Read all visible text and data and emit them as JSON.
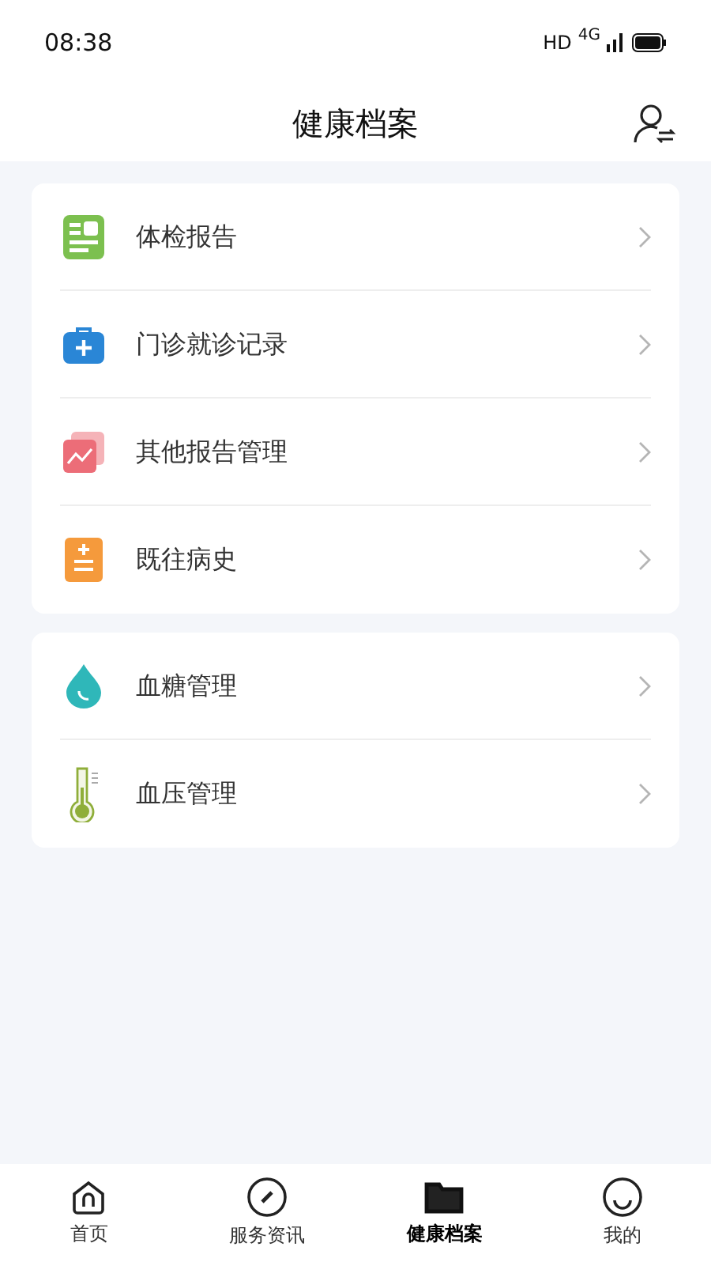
{
  "status_bar": {
    "time": "08:38",
    "network": "HD",
    "signal_label": "4G"
  },
  "header": {
    "title": "健康档案"
  },
  "groups": [
    {
      "items": [
        {
          "label": "体检报告"
        },
        {
          "label": "门诊就诊记录"
        },
        {
          "label": "其他报告管理"
        },
        {
          "label": "既往病史"
        }
      ]
    },
    {
      "items": [
        {
          "label": "血糖管理"
        },
        {
          "label": "血压管理"
        }
      ]
    }
  ],
  "tabs": [
    {
      "label": "首页",
      "selected": false
    },
    {
      "label": "服务资讯",
      "selected": false
    },
    {
      "label": "健康档案",
      "selected": true
    },
    {
      "label": "我的",
      "selected": false
    }
  ]
}
